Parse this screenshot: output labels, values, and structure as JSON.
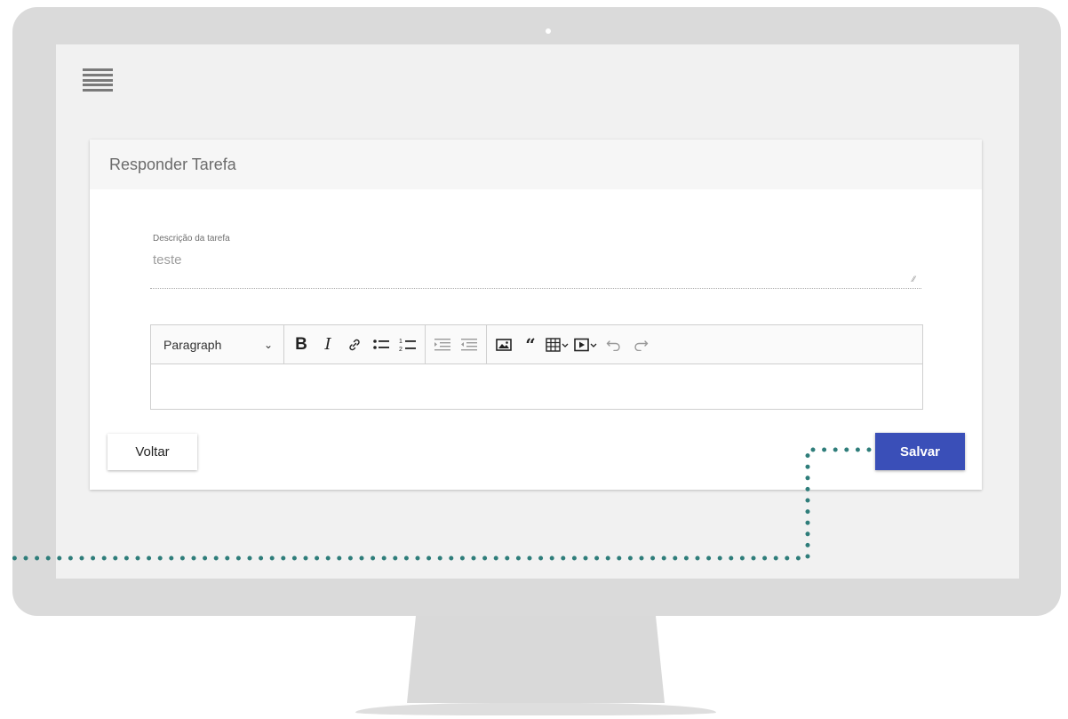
{
  "card": {
    "title": "Responder Tarefa"
  },
  "description_field": {
    "label": "Descrição da tarefa",
    "value": "teste"
  },
  "editor": {
    "heading_select": "Paragraph",
    "toolbar_icons": [
      "bold-icon",
      "italic-icon",
      "link-icon",
      "bulleted-list-icon",
      "numbered-list-icon",
      "indent-icon",
      "outdent-icon",
      "image-icon",
      "blockquote-icon",
      "table-icon",
      "media-icon",
      "undo-icon",
      "redo-icon"
    ],
    "content": ""
  },
  "actions": {
    "back_label": "Voltar",
    "save_label": "Salvar"
  },
  "colors": {
    "primary": "#3a4fb8",
    "connector": "#2e7d7a"
  }
}
